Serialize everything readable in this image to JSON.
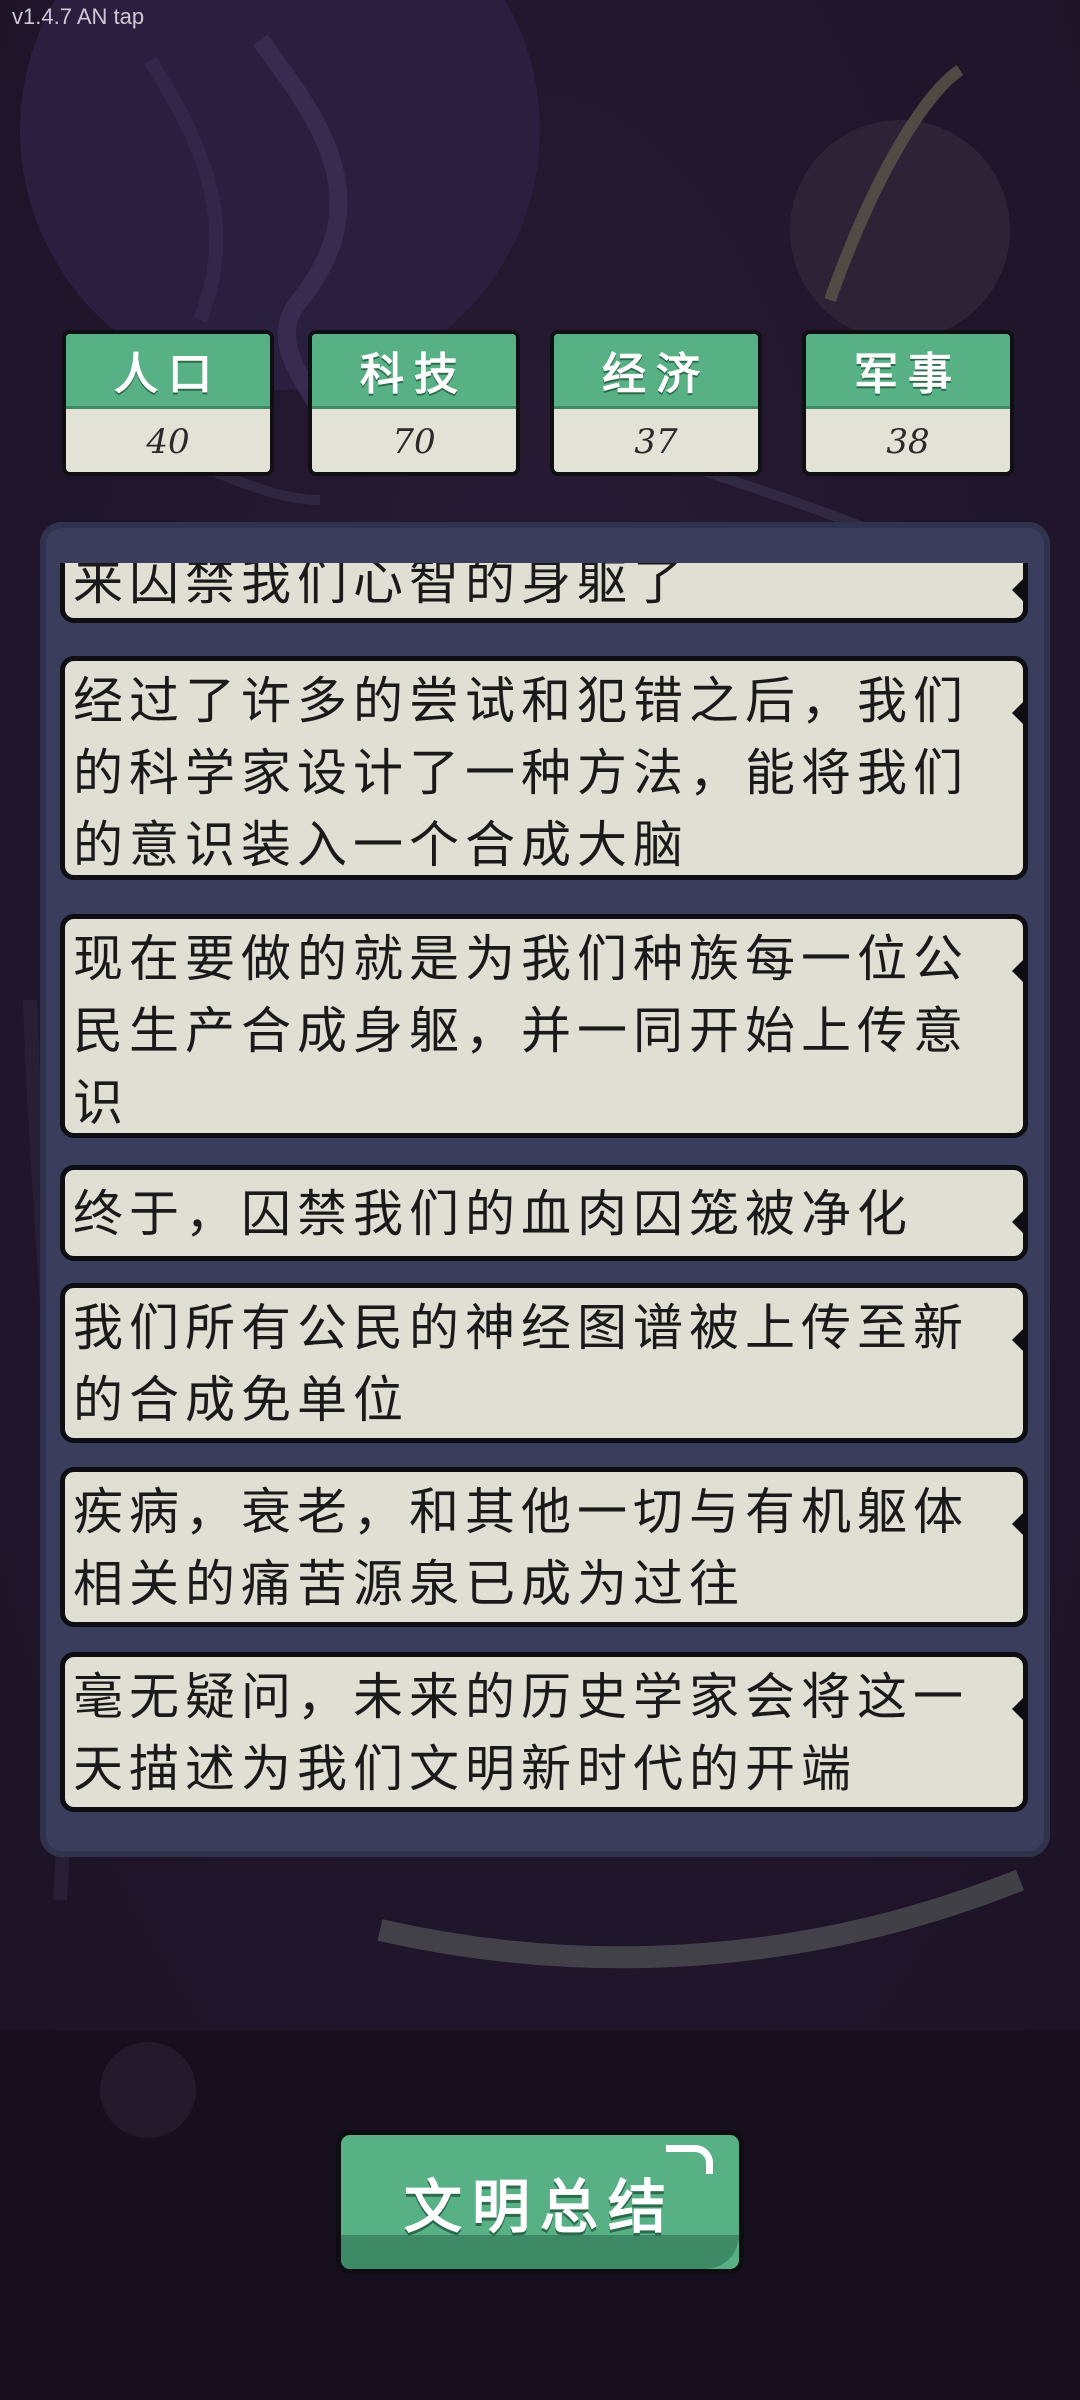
{
  "version_label": "v1.4.7 AN tap",
  "stats": [
    {
      "label": "人口",
      "value": "40"
    },
    {
      "label": "科技",
      "value": "70"
    },
    {
      "label": "经济",
      "value": "37"
    },
    {
      "label": "军事",
      "value": "38"
    }
  ],
  "log": [
    "来囚禁我们心智的身躯了",
    "经过了许多的尝试和犯错之后，我们的科学家设计了一种方法，能将我们的意识装入一个合成大脑",
    "现在要做的就是为我们种族每一位公民生产合成身躯，并一同开始上传意识",
    "终于，囚禁我们的血肉囚笼被净化",
    "我们所有公民的神经图谱被上传至新的合成免单位",
    "疾病，衰老，和其他一切与有机躯体相关的痛苦源泉已成为过往",
    "毫无疑问，未来的历史学家会将这一天描述为我们文明新时代的开端"
  ],
  "summary_button": "文明总结",
  "colors": {
    "accent_green": "#57b185",
    "panel": "#3a3d5c",
    "card": "#dfdfd4",
    "background": "#22172e"
  }
}
